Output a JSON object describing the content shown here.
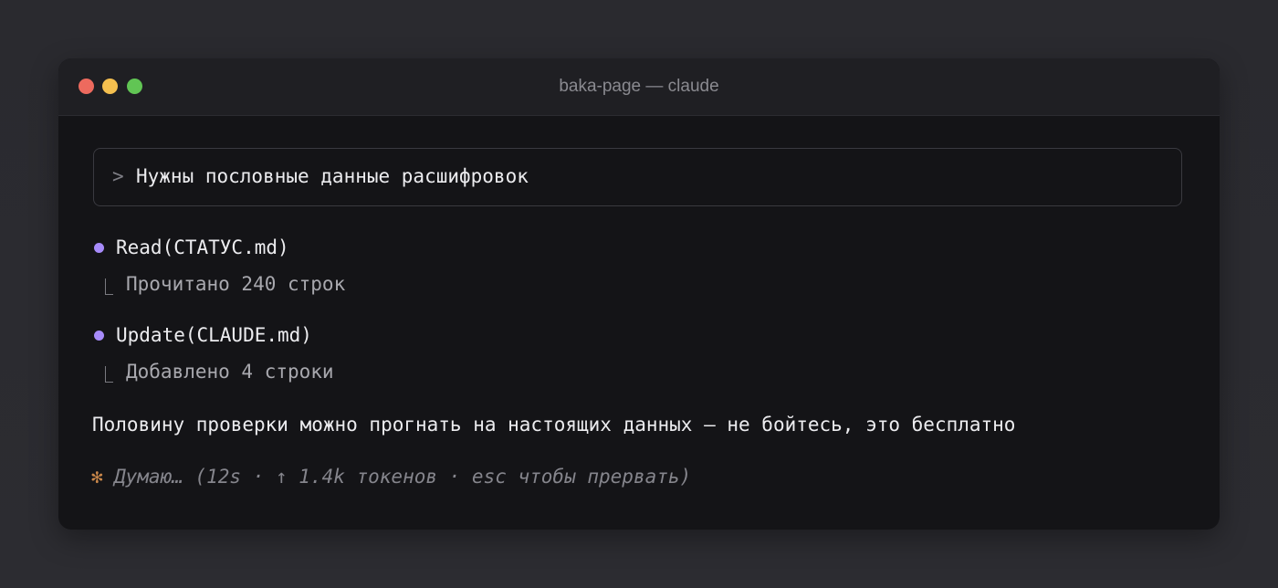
{
  "window": {
    "title": "baka-page — claude",
    "controls": {
      "close_color": "#ed6a5e",
      "minimize_color": "#f4bf4f",
      "maximize_color": "#61c554"
    }
  },
  "prompt": {
    "caret": ">",
    "text": "Нужны пословные данные расшифровок"
  },
  "tool_calls": [
    {
      "label": "Read(СТАТУС.md)",
      "result": "Прочитано 240 строк",
      "bullet_color": "#a78bfa"
    },
    {
      "label": "Update(CLAUDE.md)",
      "result": "Добавлено 4 строки",
      "bullet_color": "#a78bfa"
    }
  ],
  "message": "Половину проверки можно прогнать на настоящих данных — не бойтесь, это бесплатно",
  "status": {
    "spinner": "✻",
    "text": "Думаю… (12s · ↑ 1.4k токенов · esc чтобы прервать)",
    "spinner_color": "#c9874a"
  }
}
